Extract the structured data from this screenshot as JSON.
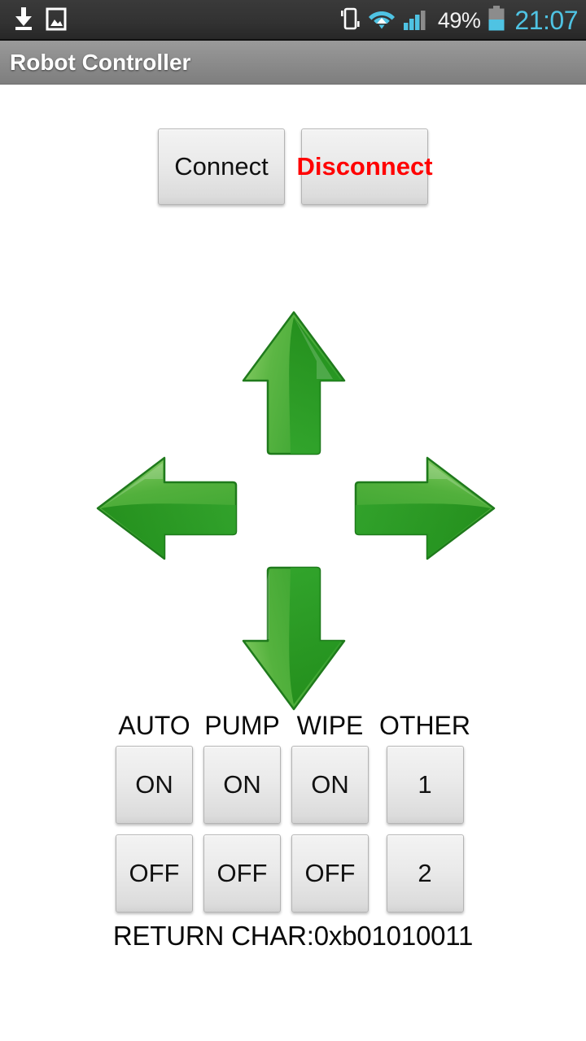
{
  "statusbar": {
    "left_icons": [
      {
        "name": "download-icon",
        "glyph": "download"
      },
      {
        "name": "gallery-image-icon",
        "glyph": "image"
      }
    ],
    "right_icons": [
      {
        "name": "vibrate-mode-icon",
        "glyph": "vibrate"
      },
      {
        "name": "wifi-icon",
        "glyph": "wifi"
      },
      {
        "name": "cellular-signal-icon",
        "glyph": "signal"
      }
    ],
    "battery_percent": "49%",
    "battery_icon": "battery-icon",
    "clock": "21:07",
    "clock_color": "#4fc3e3",
    "background": "#323232"
  },
  "titlebar": {
    "title": "Robot Controller",
    "background": "#8d8d8d",
    "text_color": "#ffffff"
  },
  "connection": {
    "connect_label": "Connect",
    "disconnect_label": "Disconnect",
    "disconnect_color": "#ff0000",
    "connect_color": "#111111"
  },
  "dpad": {
    "arrow_color_light": "#6cc24a",
    "arrow_color_dark": "#178a17",
    "buttons": [
      {
        "name": "arrow-up-button",
        "direction": "up"
      },
      {
        "name": "arrow-left-button",
        "direction": "left"
      },
      {
        "name": "arrow-right-button",
        "direction": "right"
      },
      {
        "name": "arrow-down-button",
        "direction": "down"
      }
    ]
  },
  "controls": {
    "columns": [
      {
        "label": "AUTO",
        "buttons": [
          "ON",
          "OFF"
        ]
      },
      {
        "label": "PUMP",
        "buttons": [
          "ON",
          "OFF"
        ]
      },
      {
        "label": "WIPE",
        "buttons": [
          "ON",
          "OFF"
        ]
      },
      {
        "label": "OTHER",
        "buttons": [
          "1",
          "2"
        ]
      }
    ]
  },
  "status": {
    "return_char": "RETURN CHAR:0xb01010011"
  }
}
